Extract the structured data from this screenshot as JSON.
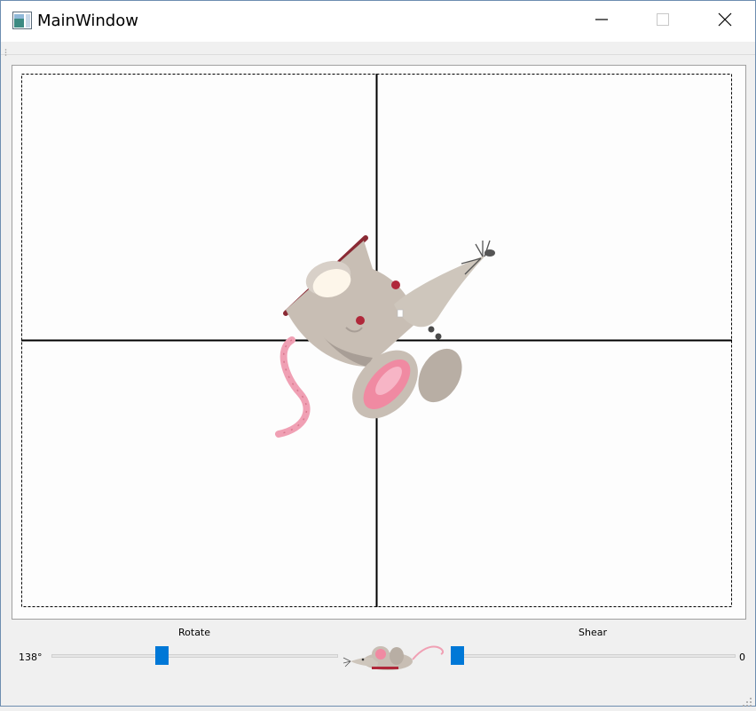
{
  "window": {
    "title": "MainWindow",
    "icons": {
      "app": "app-window-icon",
      "minimize": "minimize-icon",
      "maximize": "maximize-icon",
      "close": "close-icon"
    }
  },
  "canvas": {
    "image": "mouse-icon"
  },
  "rotate": {
    "label": "Rotate",
    "value_text": "138°",
    "value": 138
  },
  "shear": {
    "label": "Shear",
    "value_text": "0",
    "value": 0
  },
  "center_icon": "mouse-icon",
  "colors": {
    "accent": "#0078d7",
    "window_border": "#6d8db0"
  }
}
